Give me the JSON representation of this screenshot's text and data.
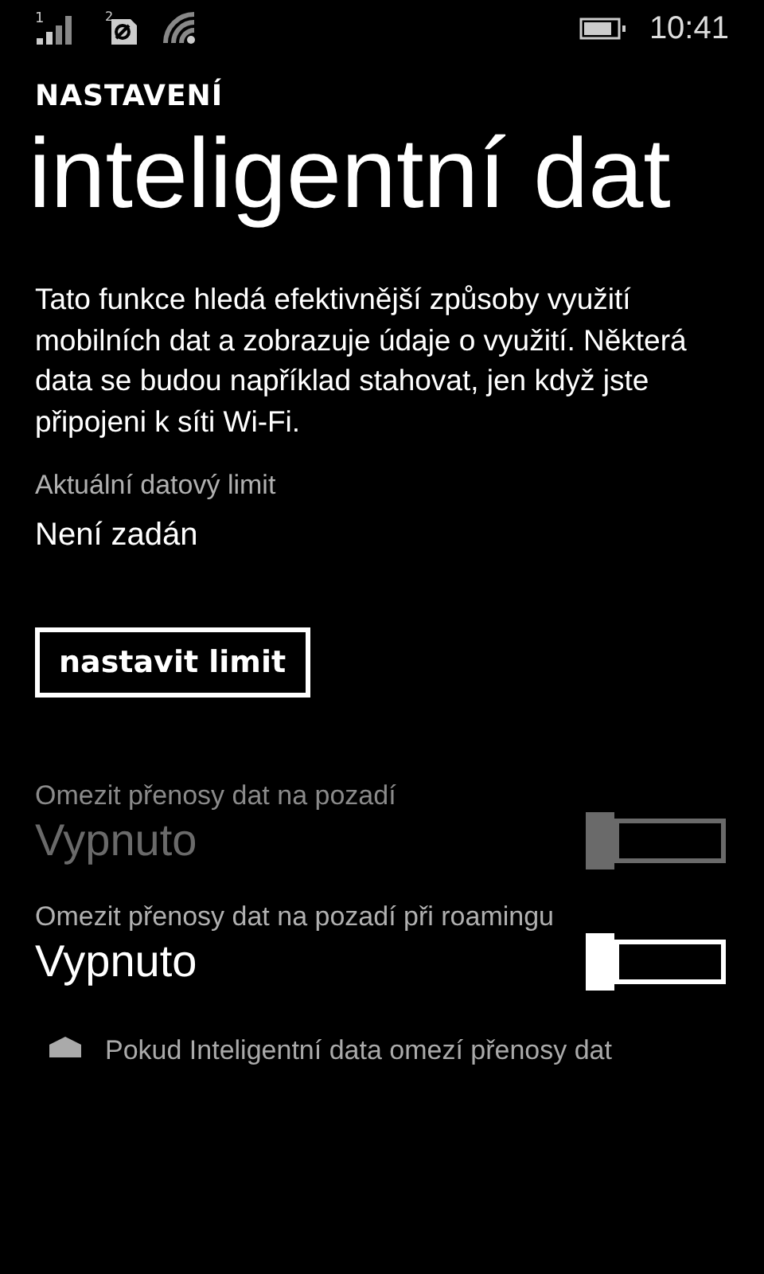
{
  "status_bar": {
    "sim_label": "1",
    "sim2_label": "2",
    "time": "10:41"
  },
  "header": {
    "section": "NASTAVENÍ",
    "title": "inteligentní dat"
  },
  "description": "Tato funkce hledá efektivnější způsoby využití mobilních dat a zobrazuje údaje o využití. Některá data se budou například stahovat, jen když jste připojeni k síti Wi-Fi.",
  "limit": {
    "label": "Aktuální datový limit",
    "value": "Není zadán",
    "button": "nastavit limit"
  },
  "toggles": [
    {
      "label": "Omezit přenosy dat na pozadí",
      "state_text": "Vypnuto",
      "on": false,
      "disabled": true
    },
    {
      "label": "Omezit přenosy dat na pozadí při roamingu",
      "state_text": "Vypnuto",
      "on": false,
      "disabled": false
    }
  ],
  "note": "Pokud Inteligentní data omezí přenosy dat"
}
